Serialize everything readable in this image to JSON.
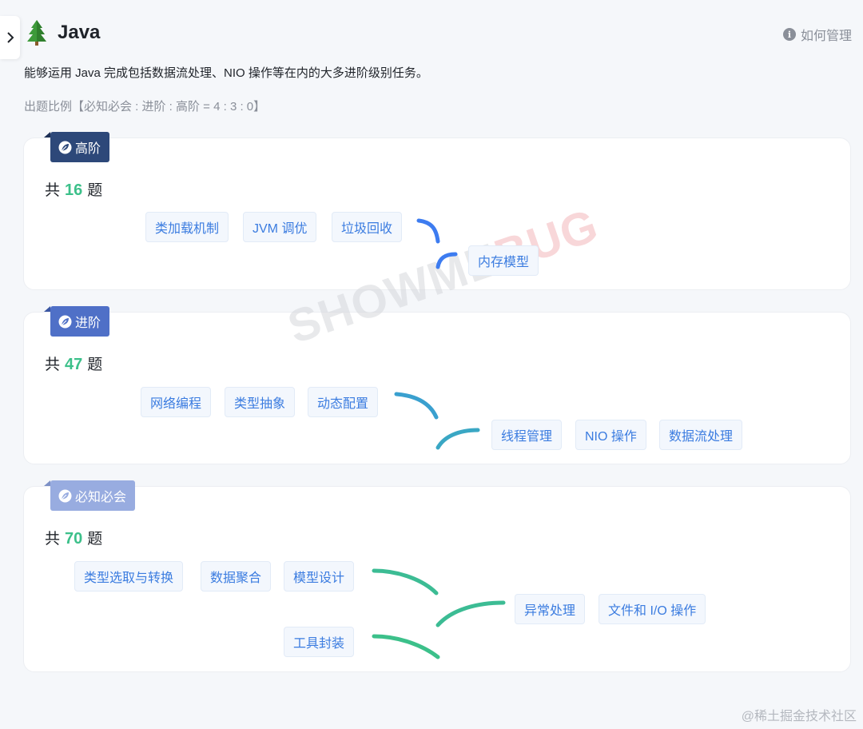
{
  "header": {
    "title": "Java",
    "manage_label": "如何管理",
    "description": "能够运用 Java 完成包括数据流处理、NIO 操作等在内的大多进阶级别任务。",
    "ratio": "出题比例【必知必会 : 进阶 : 高阶 = 4 : 3 : 0】"
  },
  "sections": {
    "high": {
      "badge": "高阶",
      "count_prefix": "共",
      "count": "16",
      "count_suffix": "题",
      "tags": [
        "类加载机制",
        "JVM 调优",
        "垃圾回收",
        "内存模型"
      ]
    },
    "mid": {
      "badge": "进阶",
      "count_prefix": "共",
      "count": "47",
      "count_suffix": "题",
      "tags": [
        "网络编程",
        "类型抽象",
        "动态配置",
        "线程管理",
        "NIO 操作",
        "数据流处理"
      ]
    },
    "basic": {
      "badge": "必知必会",
      "count_prefix": "共",
      "count": "70",
      "count_suffix": "题",
      "tags": [
        "类型选取与转换",
        "数据聚合",
        "模型设计",
        "异常处理",
        "文件和 I/O 操作",
        "工具封装"
      ]
    }
  },
  "watermark": {
    "part1": "SHOWME",
    "part2": "BUG"
  },
  "corner_mark": "@稀土掘金技术社区",
  "colors": {
    "high": "#2d4879",
    "mid": "#4f70c7",
    "basic": "#98ace0",
    "count": "#3cc08a",
    "tag_text": "#3b7ce0",
    "trunk_top": "#3d7cf0",
    "trunk_bottom": "#3cc08a"
  },
  "icons": {
    "collapse": "chevron-right-icon",
    "logo": "tree-icon",
    "manage": "info-icon",
    "badge": "leaf-icon"
  }
}
